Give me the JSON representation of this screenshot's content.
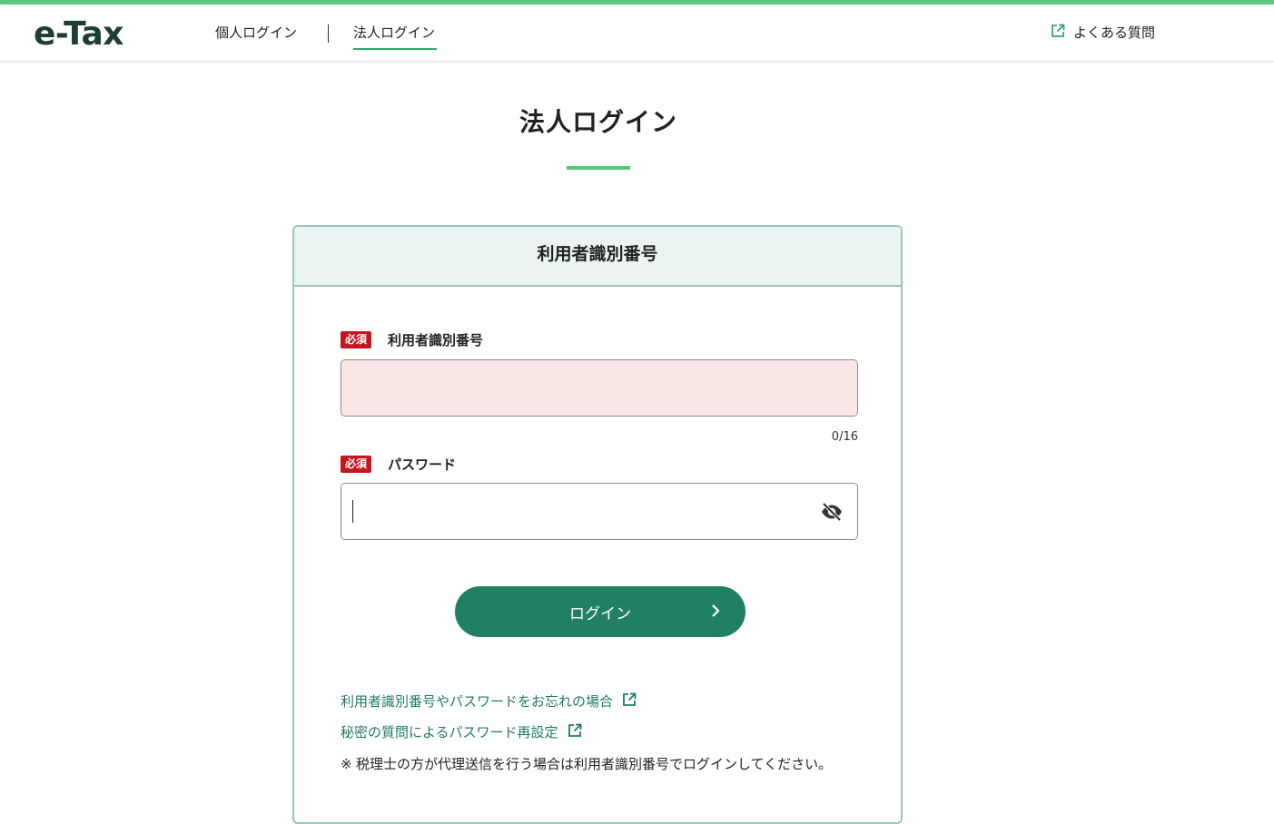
{
  "header": {
    "logo": "e-Tax",
    "nav": {
      "individual": "個人ログイン",
      "corporate": "法人ログイン"
    },
    "faq": "よくある質問"
  },
  "main": {
    "title": "法人ログイン",
    "card": {
      "heading": "利用者識別番号",
      "required_badge": "必須",
      "user_id": {
        "label": "利用者識別番号",
        "value": "",
        "counter": "0/16"
      },
      "password": {
        "label": "パスワード",
        "value": ""
      },
      "login_button": "ログイン",
      "links": {
        "forgot": "利用者識別番号やパスワードをお忘れの場合",
        "reset": "秘密の質問によるパスワード再設定"
      },
      "note": {
        "mark": "※",
        "text": "税理士の方が代理送信を行う場合は利用者識別番号でログインしてください。"
      }
    }
  },
  "colors": {
    "accent_green": "#5bcb7d",
    "button": "#217f66",
    "link": "#1f7a67",
    "required": "#c4161c"
  },
  "icons": [
    "external-link-icon",
    "eye-off-icon",
    "chevron-right-icon"
  ]
}
